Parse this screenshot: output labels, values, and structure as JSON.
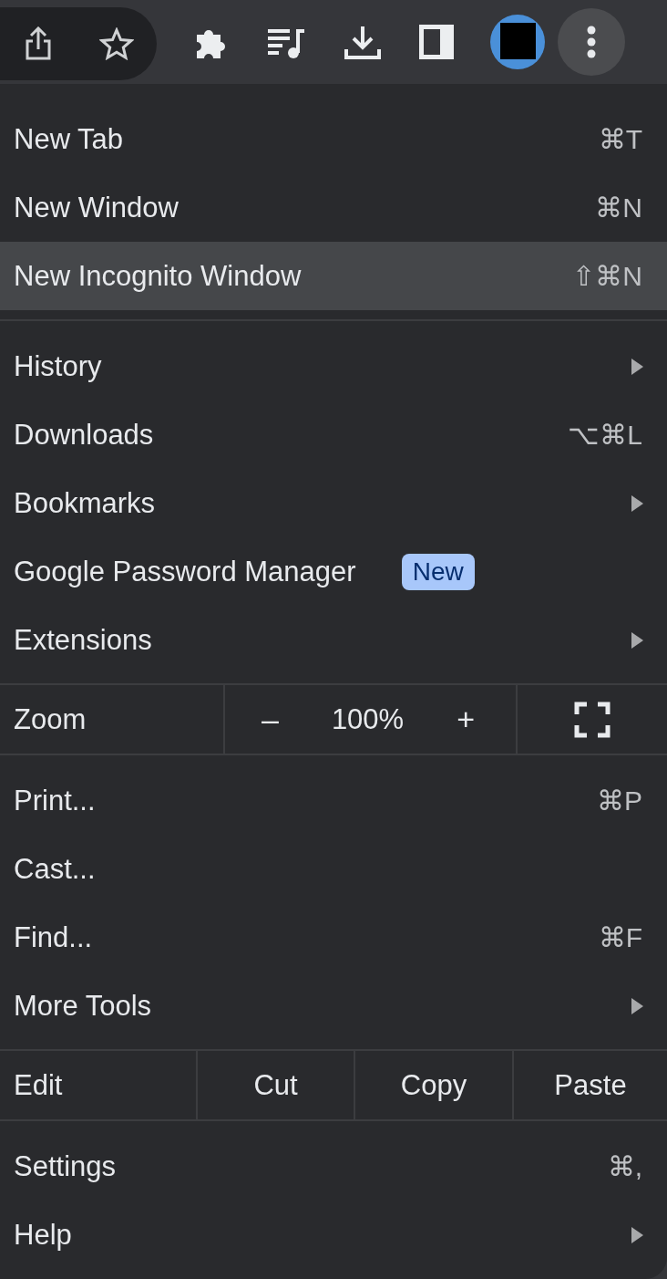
{
  "toolbar": {
    "buttons": [
      {
        "kind": "share"
      },
      {
        "kind": "star"
      },
      {
        "kind": "puzzle"
      },
      {
        "kind": "media"
      },
      {
        "kind": "download"
      },
      {
        "kind": "sidepanel"
      },
      {
        "kind": "avatar"
      },
      {
        "kind": "more"
      }
    ]
  },
  "menu": {
    "sections": [
      {
        "items": [
          {
            "label": "New Tab",
            "shortcut": "⌘T",
            "selected": false
          },
          {
            "label": "New Window",
            "shortcut": "⌘N",
            "selected": false
          },
          {
            "label": "New Incognito Window",
            "shortcut": "⇧⌘N",
            "selected": true
          }
        ]
      },
      {
        "items": [
          {
            "label": "History",
            "submenu": true,
            "selected": false
          },
          {
            "label": "Downloads",
            "shortcut": "⌥⌘L",
            "selected": false
          },
          {
            "label": "Bookmarks",
            "submenu": true,
            "selected": false
          },
          {
            "label": "Google Password Manager",
            "badge": "New",
            "selected": false
          },
          {
            "label": "Extensions",
            "submenu": true,
            "selected": false
          }
        ]
      },
      {
        "zoom": {
          "label": "Zoom",
          "minus": "–",
          "value": "100%",
          "plus": "+"
        }
      },
      {
        "items": [
          {
            "label": "Print...",
            "shortcut": "⌘P",
            "selected": false
          },
          {
            "label": "Cast...",
            "selected": false
          },
          {
            "label": "Find...",
            "shortcut": "⌘F",
            "selected": false
          },
          {
            "label": "More Tools",
            "submenu": true,
            "selected": false
          }
        ]
      },
      {
        "edit": {
          "label": "Edit",
          "actions": [
            "Cut",
            "Copy",
            "Paste"
          ]
        }
      },
      {
        "items": [
          {
            "label": "Settings",
            "shortcut": "⌘,",
            "selected": false
          },
          {
            "label": "Help",
            "submenu": true,
            "selected": false
          }
        ]
      }
    ]
  }
}
